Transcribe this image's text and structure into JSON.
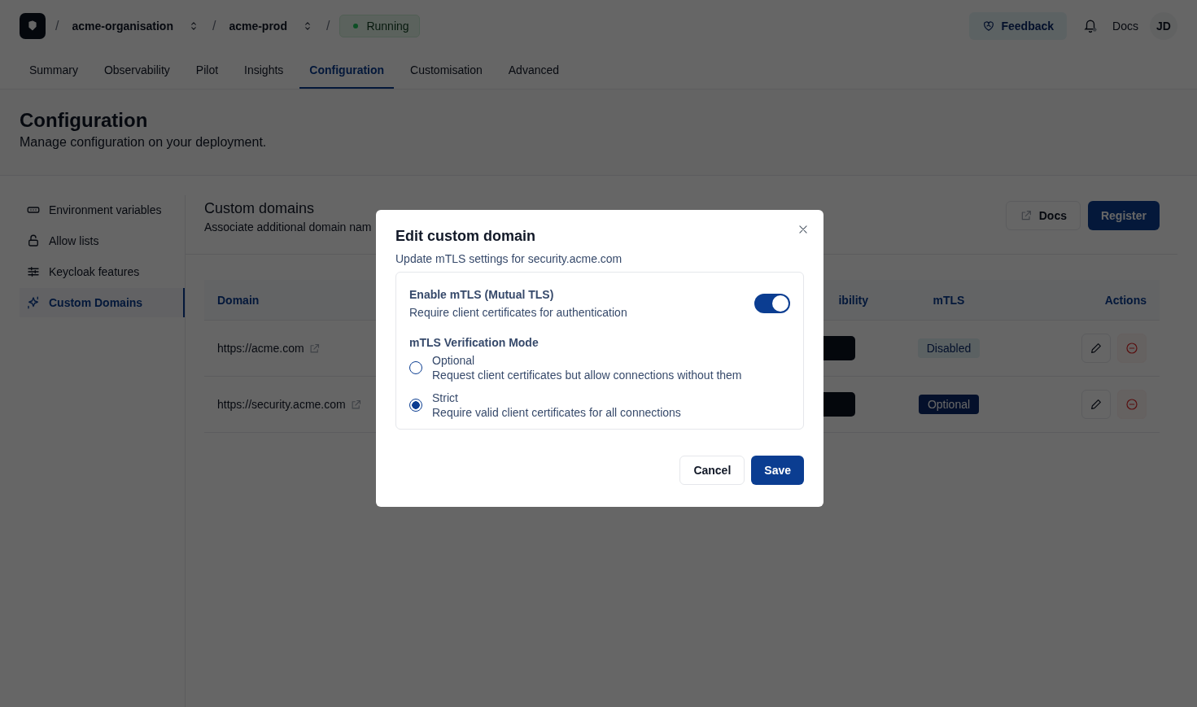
{
  "header": {
    "breadcrumbs": [
      {
        "label": "acme-organisation",
        "kind": "switcher"
      },
      {
        "label": "acme-prod",
        "kind": "switcher"
      }
    ],
    "status": {
      "label": "Running"
    },
    "feedback": "Feedback",
    "docs": "Docs",
    "avatar": "JD",
    "separator": "/"
  },
  "tabs": [
    {
      "label": "Summary",
      "selected": false
    },
    {
      "label": "Observability",
      "selected": false
    },
    {
      "label": "Pilot",
      "selected": false
    },
    {
      "label": "Insights",
      "selected": false
    },
    {
      "label": "Configuration",
      "selected": true
    },
    {
      "label": "Customisation",
      "selected": false
    },
    {
      "label": "Advanced",
      "selected": false
    }
  ],
  "page": {
    "title": "Configuration",
    "subtitle": "Manage configuration on your deployment."
  },
  "sidebar": {
    "items": [
      {
        "label": "Environment variables",
        "selected": false
      },
      {
        "label": "Allow lists",
        "selected": false
      },
      {
        "label": "Keycloak features",
        "selected": false
      },
      {
        "label": "Custom Domains",
        "selected": true
      }
    ]
  },
  "section": {
    "title": "Custom domains",
    "subtitle": "Associate additional domain nam",
    "docs": "Docs",
    "register": "Register"
  },
  "table": {
    "columns": [
      "Domain",
      "ibility",
      "mTLS",
      "Actions"
    ],
    "rows": [
      {
        "domain": "https://acme.com",
        "mtls": {
          "label": "Disabled",
          "kind": "muted"
        }
      },
      {
        "domain": "https://security.acme.com",
        "mtls": {
          "label": "Optional",
          "kind": "solid"
        }
      }
    ]
  },
  "dialog": {
    "title": "Edit custom domain",
    "subtitle": "Update mTLS settings for security.acme.com",
    "toggle": {
      "label": "Enable mTLS (Mutual TLS)",
      "description": "Require client certificates for authentication",
      "on": true
    },
    "mode": {
      "label": "mTLS Verification Mode",
      "options": [
        {
          "label": "Optional",
          "description": "Request client certificates but allow connections without them",
          "selected": false
        },
        {
          "label": "Strict",
          "description": "Require valid client certificates for all connections",
          "selected": true
        }
      ]
    },
    "buttons": {
      "cancel": "Cancel",
      "save": "Save"
    }
  }
}
